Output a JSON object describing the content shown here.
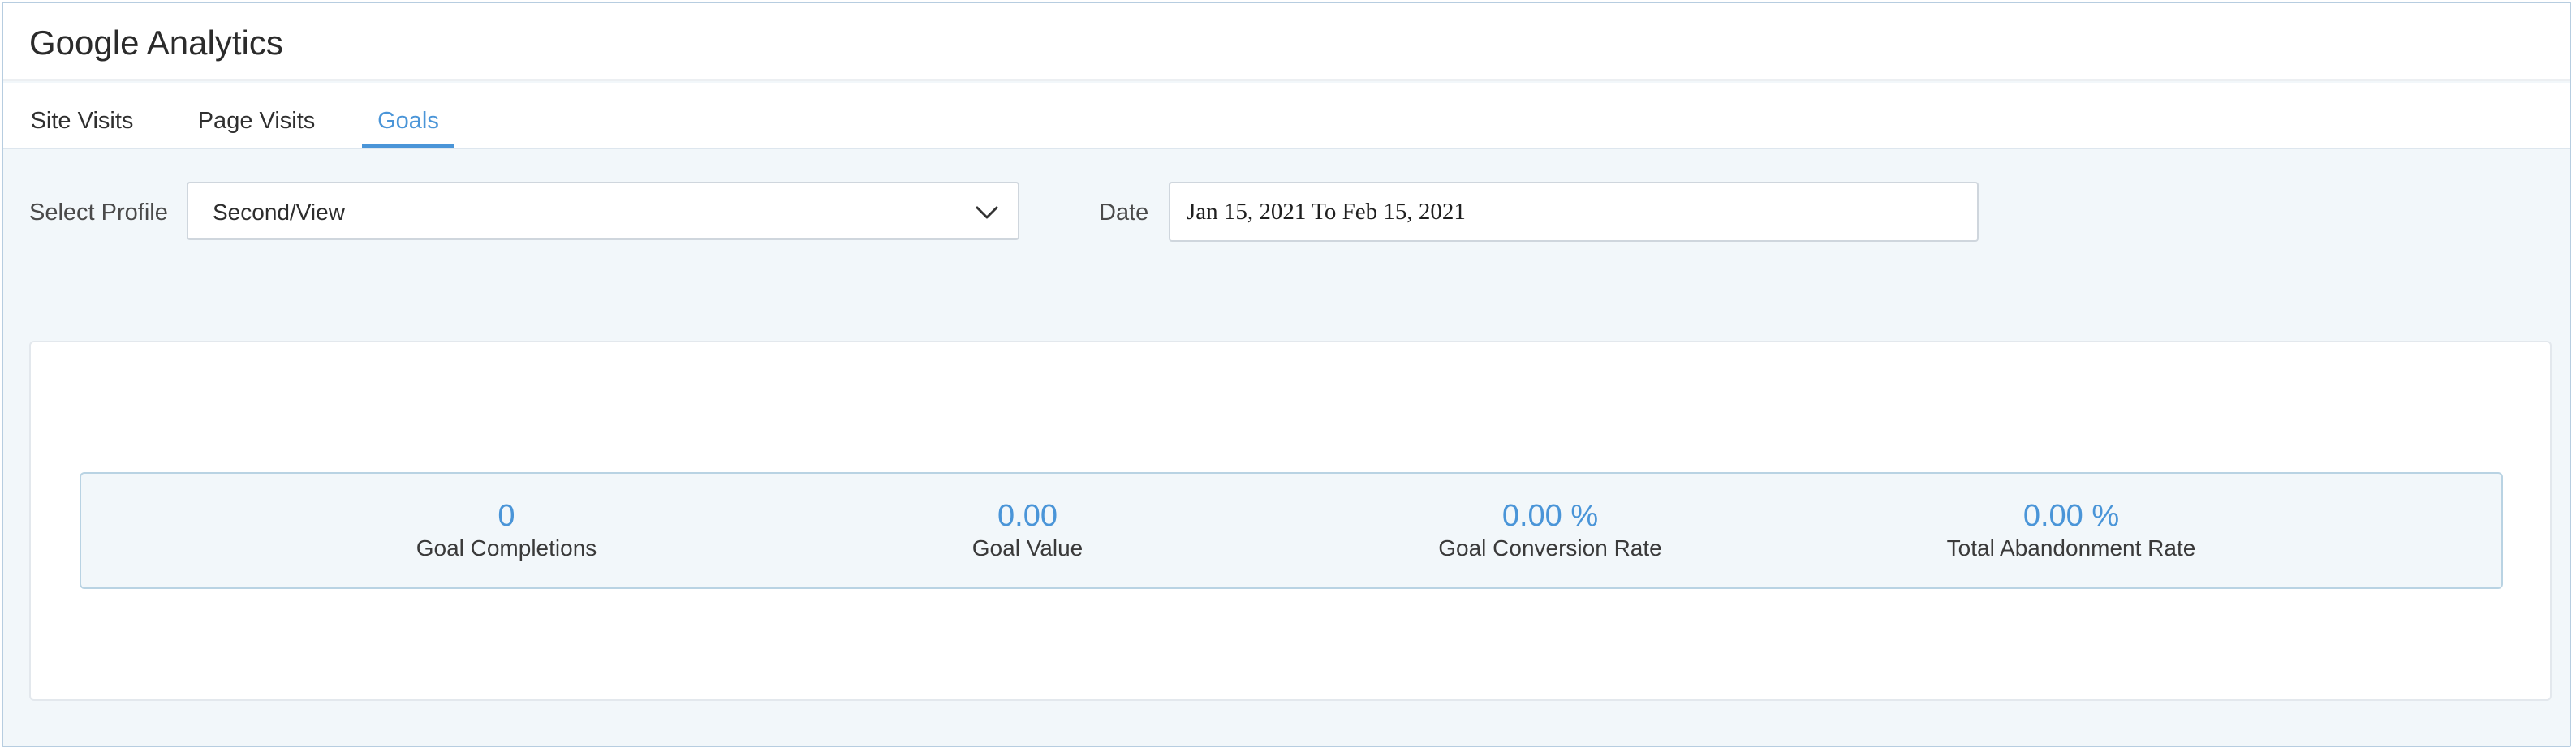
{
  "header": {
    "title": "Google Analytics"
  },
  "tabs": [
    {
      "label": "Site Visits",
      "active": false
    },
    {
      "label": "Page Visits",
      "active": false
    },
    {
      "label": "Goals",
      "active": true
    }
  ],
  "filters": {
    "profile_label": "Select Profile",
    "profile_value": "Second/View",
    "date_label": "Date",
    "date_value": "Jan 15, 2021 To Feb 15, 2021"
  },
  "stats": [
    {
      "value": "0",
      "label": "Goal Completions"
    },
    {
      "value": "0.00",
      "label": "Goal Value"
    },
    {
      "value": "0.00 %",
      "label": "Goal Conversion Rate"
    },
    {
      "value": "0.00 %",
      "label": "Total Abandonment Rate"
    }
  ],
  "colors": {
    "accent": "#4a95d8",
    "background": "#f2f7fa",
    "border": "#b7cde0"
  },
  "icons": {
    "dropdown": "chevron-down-icon"
  }
}
